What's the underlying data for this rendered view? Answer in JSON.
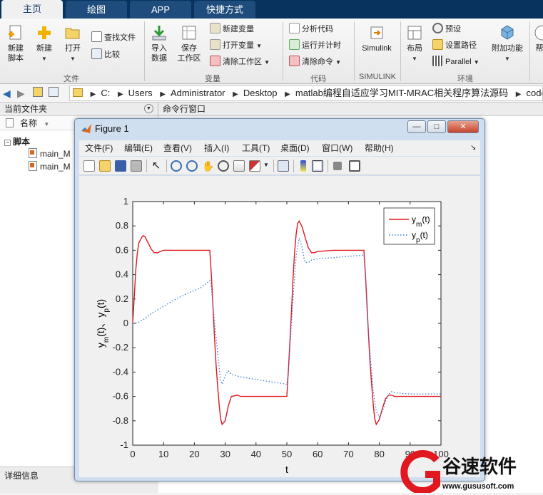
{
  "tabs": [
    "主页",
    "绘图",
    "APP",
    "快捷方式"
  ],
  "ribbon": {
    "file": {
      "new_script": "新建\n脚本",
      "new": "新建",
      "open": "打开",
      "find_files": "查找文件",
      "compare": "比较",
      "group": "文件"
    },
    "variable": {
      "import_data": "导入\n数据",
      "save_workspace": "保存\n工作区",
      "new_variable": "新建变量",
      "open_variable": "打开变量",
      "clear_workspace": "清除工作区",
      "group": "变量"
    },
    "code": {
      "analyze_code": "分析代码",
      "run_and_time": "运行并计时",
      "clear_commands": "清除命令",
      "group": "代码"
    },
    "simulink": {
      "label": "Simulink",
      "group": "SIMULINK"
    },
    "environment": {
      "layout": "布局",
      "preferences": "预设",
      "set_path": "设置路径",
      "parallel": "Parallel",
      "addons": "附加功能",
      "group": "环境",
      "help_partial": "帮"
    }
  },
  "breadcrumb": [
    "C:",
    "Users",
    "Administrator",
    "Desktop",
    "matlab编程自适应学习MIT-MRAC相关程序算法源码",
    "code"
  ],
  "left_panel": {
    "title": "当前文件夹",
    "col_name": "名称",
    "group": "脚本",
    "files": [
      "main_M",
      "main_M"
    ],
    "details": "详细信息"
  },
  "command_window": {
    "title": "命令行窗口"
  },
  "figure": {
    "title": "Figure 1",
    "menu": [
      "文件(F)",
      "编辑(E)",
      "查看(V)",
      "插入(I)",
      "工具(T)",
      "桌面(D)",
      "窗口(W)",
      "帮助(H)"
    ],
    "buttons": {
      "minimize": "—",
      "maximize": "□",
      "close": "✕"
    }
  },
  "colors": {
    "title_bar": "#08335e",
    "ym_line": "#e0181f",
    "yp_line": "#3a7fd0"
  },
  "chart_data": {
    "type": "line",
    "xlabel": "t",
    "ylabel": "y_m(t)、y_p(t)",
    "xlim": [
      0,
      100
    ],
    "ylim": [
      -1,
      1
    ],
    "xticks": [
      0,
      10,
      20,
      30,
      40,
      50,
      60,
      70,
      80,
      90,
      100
    ],
    "yticks": [
      -1,
      -0.8,
      -0.6,
      -0.4,
      -0.2,
      0,
      0.2,
      0.4,
      0.6,
      0.8,
      1
    ],
    "legend_position": "top-right",
    "series": [
      {
        "name": "y_m(t)",
        "style": "solid",
        "x": [
          0,
          0.5,
          1,
          1.5,
          2,
          3,
          3.5,
          4,
          5,
          6,
          7,
          8,
          9,
          10,
          12,
          15,
          20,
          25,
          25.5,
          26,
          26.5,
          27,
          27.5,
          28,
          28.5,
          29,
          30,
          31,
          32,
          34,
          35,
          40,
          45,
          50,
          50.5,
          51,
          51.5,
          52,
          52.5,
          53,
          53.5,
          54,
          55,
          56,
          57,
          58,
          59,
          60,
          65,
          70,
          75,
          75.5,
          76,
          76.5,
          77,
          77.5,
          78,
          78.5,
          79,
          80,
          81,
          82,
          83,
          84,
          85,
          90,
          95,
          100
        ],
        "y": [
          0,
          0.22,
          0.44,
          0.58,
          0.66,
          0.71,
          0.72,
          0.71,
          0.66,
          0.61,
          0.58,
          0.58,
          0.59,
          0.6,
          0.6,
          0.6,
          0.6,
          0.6,
          0.4,
          0.16,
          -0.1,
          -0.32,
          -0.5,
          -0.66,
          -0.78,
          -0.83,
          -0.8,
          -0.68,
          -0.6,
          -0.59,
          -0.6,
          -0.6,
          -0.6,
          -0.6,
          -0.38,
          -0.15,
          0.1,
          0.36,
          0.58,
          0.73,
          0.82,
          0.84,
          0.79,
          0.7,
          0.62,
          0.58,
          0.58,
          0.59,
          0.6,
          0.6,
          0.6,
          0.4,
          0.16,
          -0.1,
          -0.32,
          -0.5,
          -0.66,
          -0.78,
          -0.83,
          -0.79,
          -0.7,
          -0.62,
          -0.59,
          -0.59,
          -0.6,
          -0.6,
          -0.6,
          -0.6
        ]
      },
      {
        "name": "y_p(t)",
        "style": "dotted",
        "x": [
          0,
          2,
          4,
          6,
          8,
          10,
          14,
          18,
          22,
          25,
          25.5,
          26,
          27,
          28,
          28.5,
          29,
          30,
          31,
          32,
          35,
          40,
          45,
          50,
          50.5,
          51,
          52,
          53,
          54,
          55,
          55.5,
          56,
          57,
          58,
          60,
          65,
          70,
          75,
          75.5,
          76,
          77,
          78,
          79,
          80,
          81,
          82,
          83,
          84,
          85,
          90,
          95,
          100
        ],
        "y": [
          0,
          0.01,
          0.04,
          0.08,
          0.11,
          0.14,
          0.2,
          0.25,
          0.29,
          0.35,
          0.3,
          0.15,
          -0.1,
          -0.35,
          -0.47,
          -0.5,
          -0.43,
          -0.39,
          -0.42,
          -0.44,
          -0.46,
          -0.48,
          -0.5,
          -0.4,
          -0.2,
          0.2,
          0.55,
          0.7,
          0.62,
          0.54,
          0.5,
          0.5,
          0.52,
          0.53,
          0.54,
          0.55,
          0.56,
          0.38,
          0.1,
          -0.25,
          -0.55,
          -0.72,
          -0.77,
          -0.72,
          -0.64,
          -0.58,
          -0.56,
          -0.57,
          -0.58,
          -0.58,
          -0.58
        ]
      }
    ]
  },
  "watermark": {
    "brand": "谷速软件",
    "url": "www.gususoft.com"
  }
}
